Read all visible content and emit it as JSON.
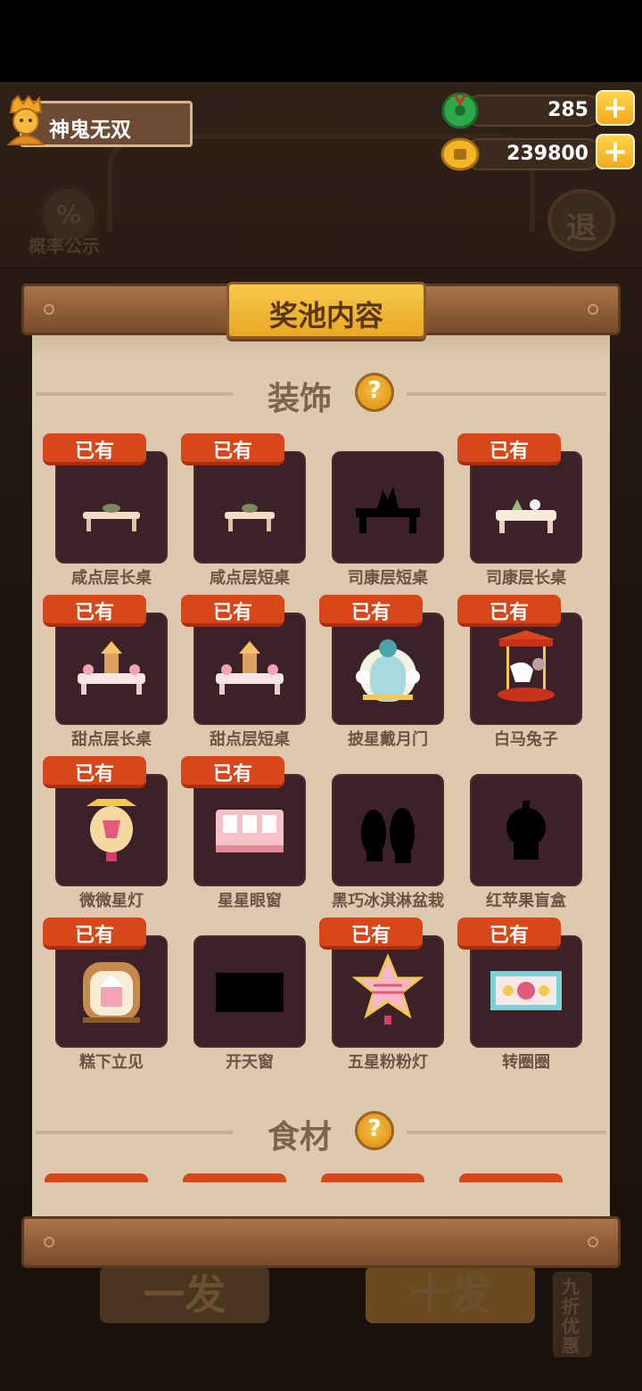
{
  "user": {
    "name": "神鬼无双"
  },
  "currency": {
    "gems": "285",
    "coins": "239800",
    "plus_label": "+"
  },
  "background": {
    "prob_symbol": "%",
    "prob_label": "概率公示",
    "exit_label": "退",
    "btn_one": "一发",
    "btn_ten": "十发",
    "discount": "九折优惠"
  },
  "panel": {
    "title": "奖池内容",
    "help_label": "?",
    "sections": [
      {
        "title": "装饰"
      },
      {
        "title": "食材"
      }
    ],
    "owned_label": "已有",
    "items": [
      {
        "name": "咸点层长桌",
        "owned": true,
        "type": "table-light"
      },
      {
        "name": "咸点层短桌",
        "owned": true,
        "type": "table-short"
      },
      {
        "name": "司康层短桌",
        "owned": false,
        "type": "silhouette-table"
      },
      {
        "name": "司康层长桌",
        "owned": true,
        "type": "table-cream"
      },
      {
        "name": "甜点层长桌",
        "owned": true,
        "type": "dessert-table"
      },
      {
        "name": "甜点层短桌",
        "owned": true,
        "type": "dessert-table"
      },
      {
        "name": "披星戴月门",
        "owned": true,
        "type": "door"
      },
      {
        "name": "白马兔子",
        "owned": true,
        "type": "carousel"
      },
      {
        "name": "微微星灯",
        "owned": true,
        "type": "lantern"
      },
      {
        "name": "星星眼窗",
        "owned": true,
        "type": "window"
      },
      {
        "name": "黑巧冰淇淋盆栽",
        "owned": false,
        "type": "silhouette-plants"
      },
      {
        "name": "红苹果盲盒",
        "owned": false,
        "type": "silhouette-box"
      },
      {
        "name": "糕下立见",
        "owned": true,
        "type": "cabinet"
      },
      {
        "name": "开天窗",
        "owned": false,
        "type": "silhouette-rect"
      },
      {
        "name": "五星粉粉灯",
        "owned": true,
        "type": "star-lamp"
      },
      {
        "name": "转圈圈",
        "owned": true,
        "type": "poster"
      }
    ]
  }
}
